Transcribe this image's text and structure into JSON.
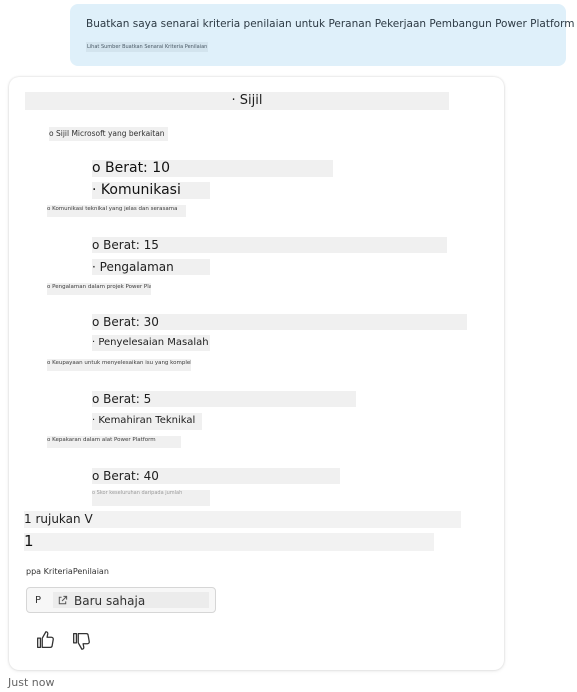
{
  "prompt": {
    "text": "Buatkan saya senarai kriteria penilaian untuk Peranan Pekerjaan Pembangun Power Platform",
    "subtext": "Lihat Sumber Buatkan Senarai Kriteria Penilaian"
  },
  "reply": {
    "lines": [
      "· Sijil",
      "o Sijil Microsoft yang berkaitan",
      "o Berat: 10",
      "· Komunikasi",
      "o Komunikasi teknikal yang jelas dan serasama",
      "o Berat: 15",
      "· Pengalaman",
      "o Pengalaman dalam projek Power Platform",
      "o Berat: 30",
      "· Penyelesaian Masalah",
      "o Keupayaan untuk menyelesaikan isu yang kompleks",
      "o Berat: 5",
      "· Kemahiran Teknikal",
      "o Kepakaran dalam alat Power Platform",
      "o Berat: 40",
      "o Skor keseluruhan daripada jumlah"
    ],
    "references_label": "1 rujukan V",
    "reference_number": "1",
    "citation_text": "ppa KriteriaPenilaian",
    "source": {
      "number": "P",
      "label": "Baru sahaja"
    },
    "timestamp": "Just now"
  },
  "icons": {
    "link": "external-link-icon",
    "like": "thumbs-up-icon",
    "dislike": "thumbs-down-icon"
  },
  "colors": {
    "user_bubble": "#dff0fa",
    "highlight_strip": "#f0f0f0"
  }
}
